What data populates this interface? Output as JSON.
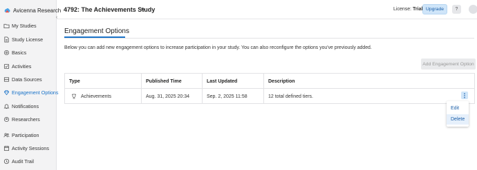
{
  "app": {
    "name": "Avicenna Research"
  },
  "header": {
    "study_title": "4792: The Achievements Study",
    "license_prefix": "License:",
    "license_value": "Trial",
    "upgrade_label": "Upgrade",
    "help_label": "?"
  },
  "sidebar": {
    "items": [
      {
        "label": "My Studies",
        "icon": "folder-icon"
      },
      {
        "label": "Study License",
        "icon": "document-icon"
      },
      {
        "label": "Basics",
        "icon": "gear-icon"
      },
      {
        "label": "Activities",
        "icon": "activity-icon"
      },
      {
        "label": "Data Sources",
        "icon": "data-icon"
      },
      {
        "label": "Engagement Options",
        "icon": "diamond-icon",
        "active": true
      },
      {
        "label": "Notifications",
        "icon": "bell-icon"
      },
      {
        "label": "Researchers",
        "icon": "gear-people-icon"
      },
      {
        "label": "Participation",
        "icon": "people-icon"
      },
      {
        "label": "Activity Sessions",
        "icon": "calendar-icon"
      },
      {
        "label": "Audit Trail",
        "icon": "clock-icon"
      }
    ]
  },
  "main": {
    "title": "Engagement Options",
    "intro": "Below you can add new engagement options to increase participation in your study. You can also reconfigure the options you've previously added.",
    "add_button": "Add Engagement Option",
    "table": {
      "columns": [
        "Type",
        "Published Time",
        "Last Updated",
        "Description"
      ],
      "rows": [
        {
          "type": "Achievements",
          "published": "Aug. 31, 2025 20:34",
          "updated": "Sep. 2, 2025 11:58",
          "description": "12 total defined tiers."
        }
      ]
    },
    "row_menu": {
      "items": [
        "Edit",
        "Delete"
      ]
    }
  },
  "colors": {
    "accent": "#1a73c8",
    "sidebar_bg": "#f3f3f4",
    "upgrade_bg": "#cfe5f9"
  }
}
